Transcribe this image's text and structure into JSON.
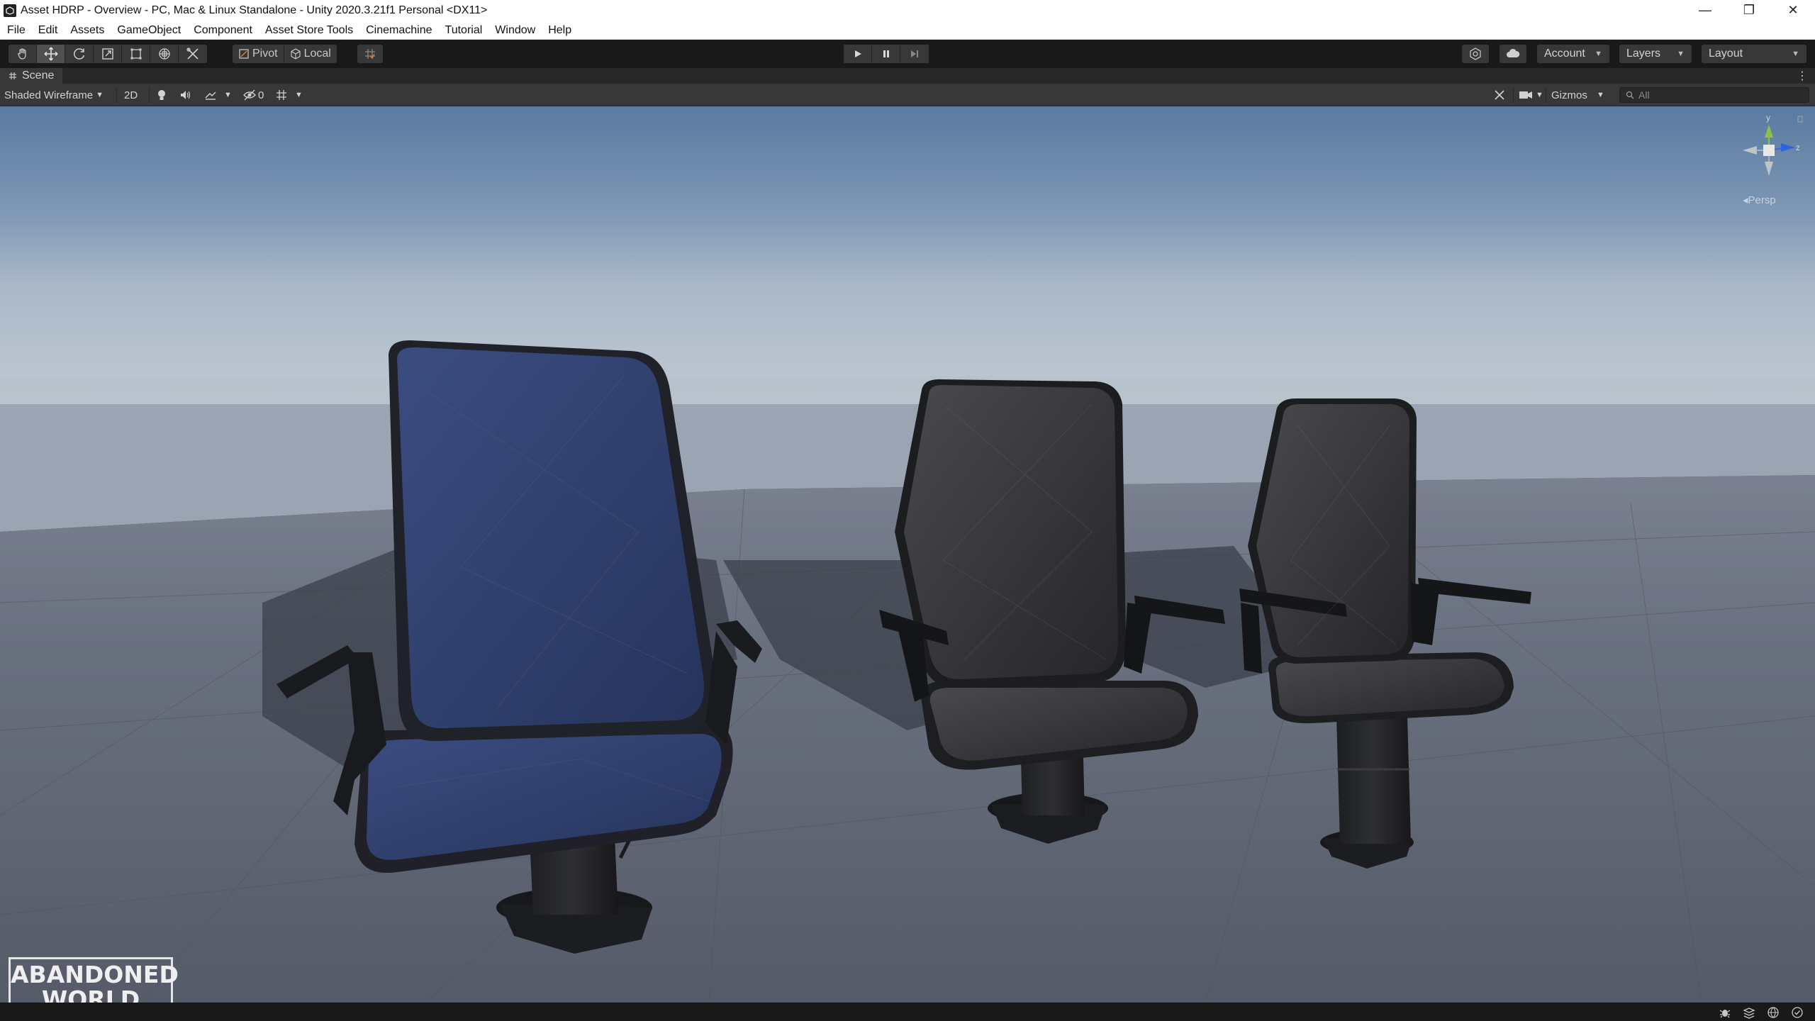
{
  "window": {
    "title": "Asset HDRP - Overview - PC, Mac & Linux Standalone - Unity 2020.3.21f1 Personal <DX11>",
    "controls": {
      "minimize": "—",
      "restore": "❐",
      "close": "✕"
    }
  },
  "menubar": {
    "items": [
      "File",
      "Edit",
      "Assets",
      "GameObject",
      "Component",
      "Asset Store Tools",
      "Cinemachine",
      "Tutorial",
      "Window",
      "Help"
    ]
  },
  "toolbar": {
    "tools": [
      {
        "icon": "hand-icon"
      },
      {
        "icon": "move-icon",
        "active": true
      },
      {
        "icon": "rotate-icon"
      },
      {
        "icon": "scale-icon"
      },
      {
        "icon": "rect-tool-icon"
      },
      {
        "icon": "transform-icon"
      },
      {
        "icon": "custom-tool-icon"
      }
    ],
    "pivot_label": "Pivot",
    "local_label": "Local",
    "play_icon": "play-icon",
    "pause_icon": "pause-icon",
    "step_icon": "step-icon",
    "account_label": "Account",
    "layers_label": "Layers",
    "layout_label": "Layout"
  },
  "scene_tab": {
    "label": "Scene",
    "more": "⋮"
  },
  "scene_toolbar": {
    "draw_mode": "Shaded Wireframe",
    "mode_2d": "2D",
    "hidden_count": "0",
    "gizmos_label": "Gizmos",
    "search_placeholder": "All"
  },
  "viewport": {
    "projection_label": "Persp",
    "gizmo_axes": [
      "y",
      "z"
    ],
    "sky_color_top": "#5f7ea3",
    "horizon_color": "#b7c3cf",
    "ground_color": "#5e6573"
  },
  "logo": {
    "line1": "ABANDONED",
    "line2": "WORLD"
  }
}
